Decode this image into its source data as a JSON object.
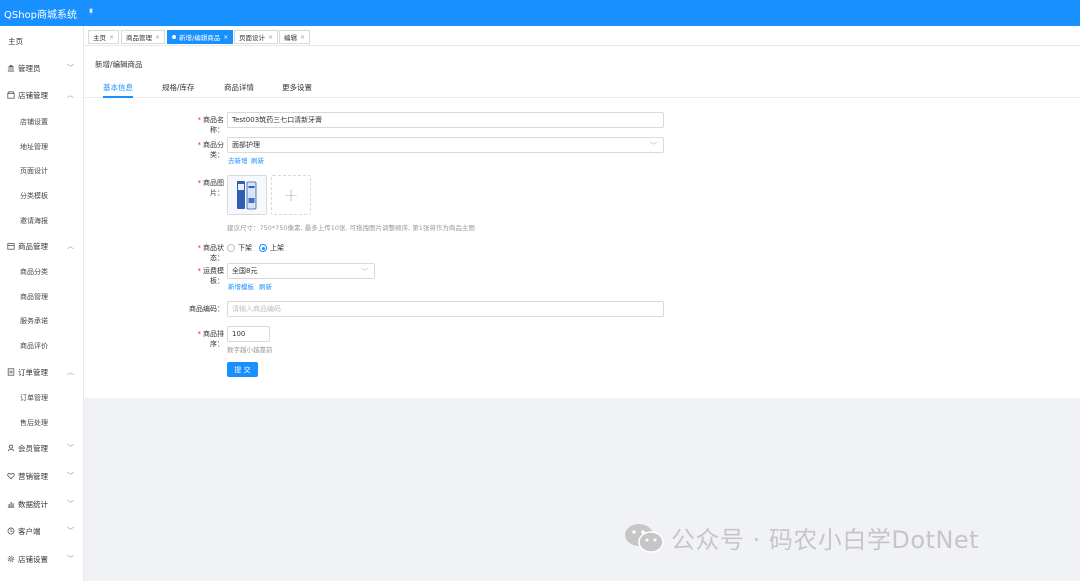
{
  "app": {
    "title": "QShop商城系统",
    "pin_icon": "pin-icon"
  },
  "sidebar": {
    "home": "主页",
    "groups": [
      {
        "label": "管理员",
        "icon": "bank-icon",
        "expanded": false,
        "children": []
      },
      {
        "label": "店铺管理",
        "icon": "shop-icon",
        "expanded": true,
        "children": [
          "店铺设置",
          "地址管理",
          "页面设计",
          "分类模板",
          "邀请海报"
        ]
      },
      {
        "label": "商品管理",
        "icon": "goods-icon",
        "expanded": true,
        "children": [
          "商品分类",
          "商品管理",
          "服务承诺",
          "商品评价"
        ]
      },
      {
        "label": "订单管理",
        "icon": "order-icon",
        "expanded": true,
        "children": [
          "订单管理",
          "售后处理"
        ]
      },
      {
        "label": "会员管理",
        "icon": "user-icon",
        "expanded": false,
        "children": []
      },
      {
        "label": "营销管理",
        "icon": "heart-icon",
        "expanded": false,
        "children": []
      },
      {
        "label": "数据统计",
        "icon": "chart-icon",
        "expanded": false,
        "children": []
      },
      {
        "label": "客户端",
        "icon": "client-icon",
        "expanded": false,
        "children": []
      },
      {
        "label": "店铺设置",
        "icon": "gear-icon",
        "expanded": false,
        "children": []
      }
    ]
  },
  "tabs": [
    {
      "label": "主页",
      "active": false
    },
    {
      "label": "商品管理",
      "active": false
    },
    {
      "label": "新增/编辑商品",
      "active": true
    },
    {
      "label": "页面设计",
      "active": false
    },
    {
      "label": "编辑",
      "active": false
    }
  ],
  "page": {
    "title": "新增/编辑商品",
    "subtabs": [
      "基本信息",
      "规格/库存",
      "商品详情",
      "更多设置"
    ],
    "active_subtab": 0
  },
  "form": {
    "name_label": "商品名称：",
    "name_value": "Test003筑药三七口清新牙膏",
    "category_label": "商品分类：",
    "category_value": "面部护理",
    "category_links": [
      "去新增",
      "刷新"
    ],
    "images_label": "商品图片：",
    "images_hint": "建议尺寸：750*750像素, 最多上传10张, 可拖拽图片调整顺序, 第1张将作为商品主图",
    "status_label": "商品状态：",
    "status_options": [
      "下架",
      "上架"
    ],
    "status_selected": 1,
    "shipping_label": "运费模板：",
    "shipping_value": "全国8元",
    "shipping_links": [
      "新增模板",
      "刷新"
    ],
    "code_label": "商品编码：",
    "code_placeholder": "请输入商品编码",
    "sort_label": "商品排序：",
    "sort_value": "100",
    "sort_hint": "数字越小越靠前",
    "submit_label": "提 交"
  },
  "watermark": {
    "text": "公众号 · 码农小白学DotNet"
  },
  "colors": {
    "primary": "#1890ff",
    "required": "#f5222d",
    "background": "#f0f2f5"
  }
}
